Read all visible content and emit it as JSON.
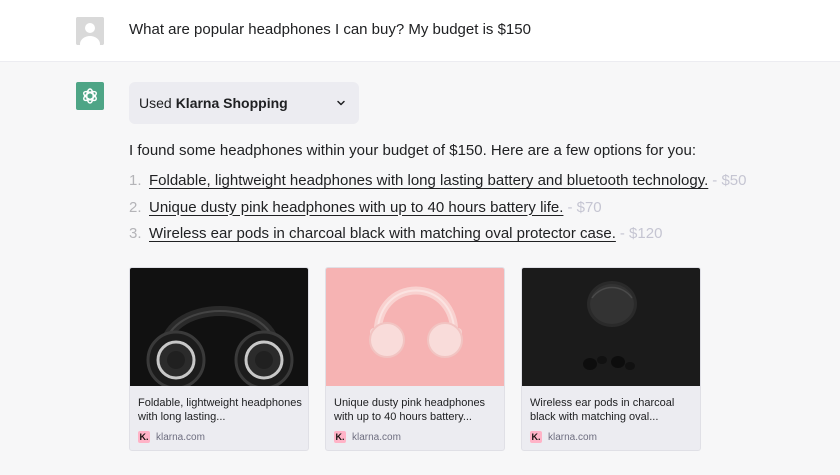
{
  "user": {
    "avatar_icon": "user-avatar-icon",
    "message": "What are popular headphones I can buy? My budget is $150"
  },
  "assistant": {
    "avatar_icon": "openai-logo-icon",
    "plugin": {
      "used_label": "Used",
      "name": "Klarna Shopping",
      "chevron_icon": "chevron-down-icon"
    },
    "intro": "I found some headphones within your budget of $150. Here are a few options for you:",
    "results": [
      {
        "number": "1.",
        "title": "Foldable, lightweight headphones with long lasting battery and bluetooth technology.",
        "price": "- $50"
      },
      {
        "number": "2.",
        "title": "Unique dusty pink headphones with up to 40 hours battery life.",
        "price": "- $70"
      },
      {
        "number": "3.",
        "title": "Wireless ear pods in charcoal black with matching oval protector case.",
        "price": "- $120"
      }
    ],
    "cards": [
      {
        "title": "Foldable, lightweight headphones with long lasting...",
        "source": "klarna.com",
        "logo": "K.",
        "image": "black-headphones-image"
      },
      {
        "title": "Unique dusty pink headphones with up to 40 hours battery...",
        "source": "klarna.com",
        "logo": "K.",
        "image": "pink-headphones-image"
      },
      {
        "title": "Wireless ear pods in charcoal black with matching oval...",
        "source": "klarna.com",
        "logo": "K.",
        "image": "black-earpods-image"
      }
    ]
  },
  "colors": {
    "assistant_bg": "#f7f7f8",
    "gpt_green": "#4ea586",
    "klarna_pink": "#ffb3c7",
    "price_gray": "#c5c5d2"
  }
}
